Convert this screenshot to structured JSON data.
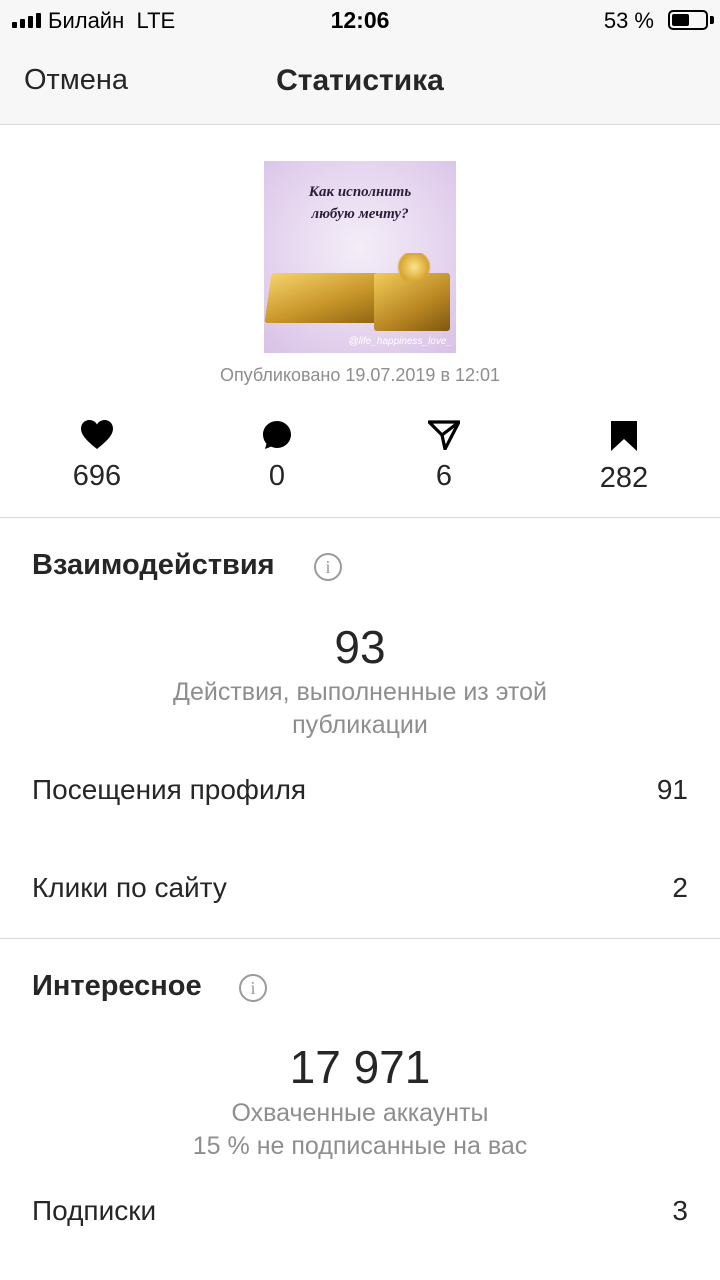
{
  "status_bar": {
    "carrier": "Билайн",
    "network": "LTE",
    "time": "12:06",
    "battery_percent": "53 %",
    "battery_level": 0.53
  },
  "nav": {
    "cancel_label": "Отмена",
    "title": "Статистика"
  },
  "post": {
    "caption_line1": "Как исполнить",
    "caption_line2": "любую мечту?",
    "handle": "@life_happiness_love_",
    "published": "Опубликовано 19.07.2019 в 12:01"
  },
  "metrics": {
    "likes": "696",
    "comments": "0",
    "shares": "6",
    "saves": "282"
  },
  "interactions": {
    "title": "Взаимодействия",
    "total": "93",
    "total_desc_line1": "Действия, выполненные из этой",
    "total_desc_line2": "публикации",
    "rows": [
      {
        "label": "Посещения профиля",
        "value": "91"
      },
      {
        "label": "Клики по сайту",
        "value": "2"
      }
    ]
  },
  "discovery": {
    "title": "Интересное",
    "total": "17 971",
    "desc_line1": "Охваченные аккаунты",
    "desc_line2": "15 % не подписанные на вас",
    "rows": [
      {
        "label": "Подписки",
        "value": "3"
      }
    ]
  },
  "colors": {
    "text": "#262626",
    "secondary": "#8e8e8e",
    "divider": "#dbdbdb",
    "bar_bg": "#f7f7f7"
  }
}
